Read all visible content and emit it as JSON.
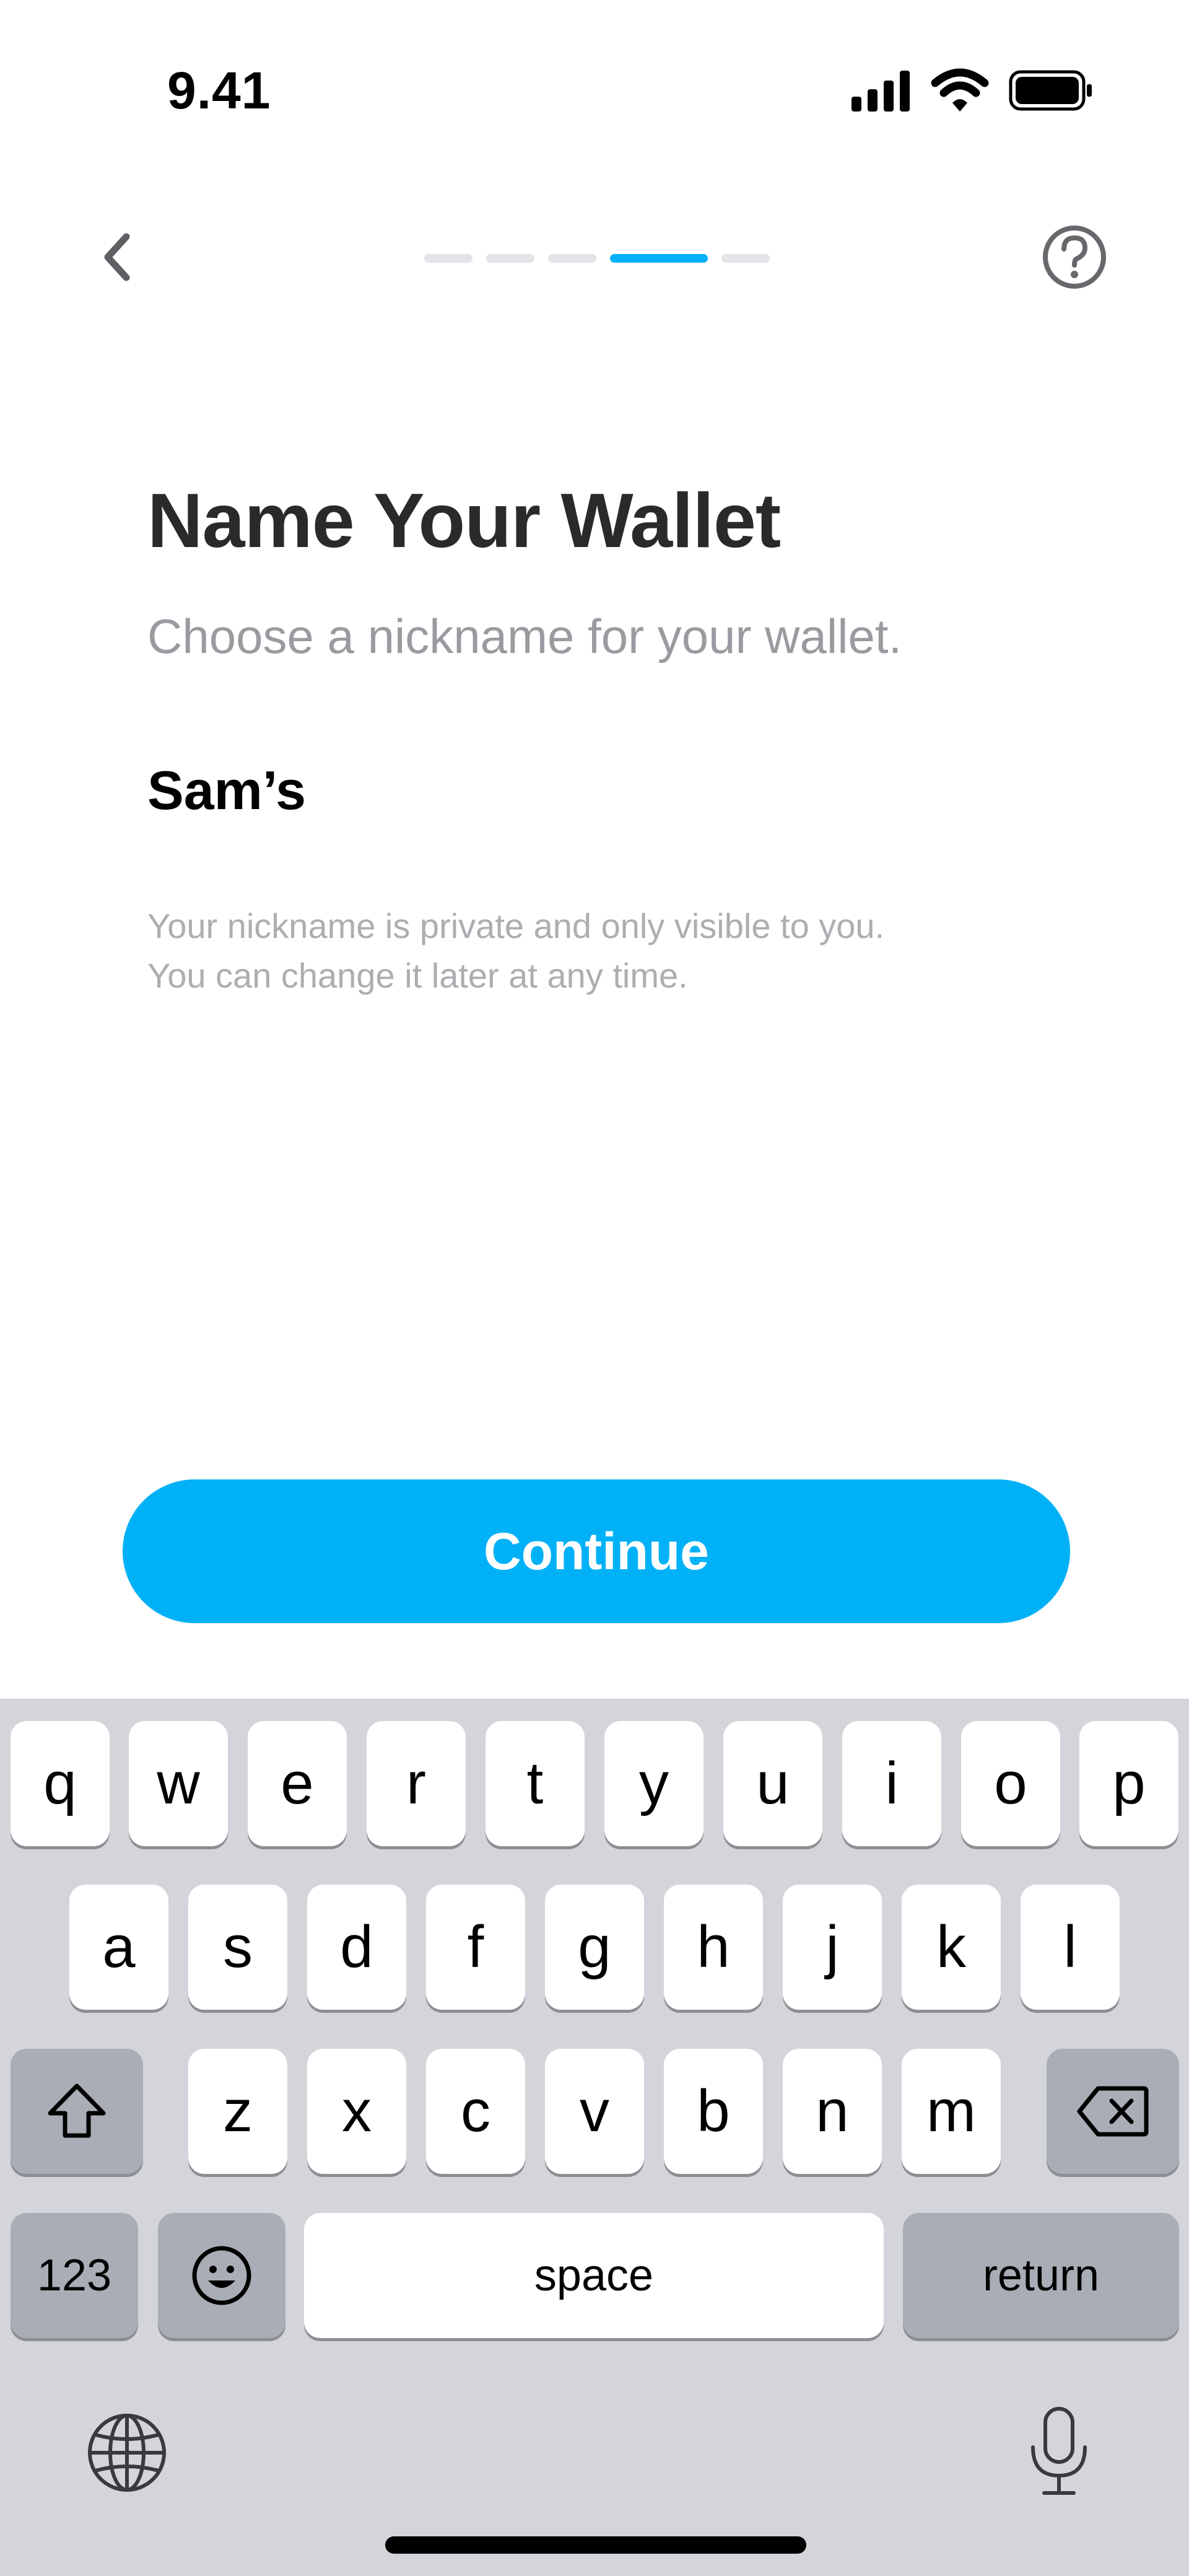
{
  "status_bar": {
    "time": "9.41",
    "icons": [
      "cellular-signal-icon",
      "wifi-icon",
      "battery-icon"
    ]
  },
  "nav": {
    "back_icon": "chevron-left-icon",
    "help_icon": "question-circle-icon",
    "progress": {
      "total_steps": 5,
      "current_step": 4
    }
  },
  "content": {
    "title": "Name Your Wallet",
    "subtitle": "Choose a nickname for your wallet.",
    "nickname_value": "Sam’s",
    "help_line1": "Your nickname is private and only visible to you.",
    "help_line2": "You can change it later at any time."
  },
  "actions": {
    "continue_label": "Continue"
  },
  "keyboard": {
    "row1": [
      "q",
      "w",
      "e",
      "r",
      "t",
      "y",
      "u",
      "i",
      "o",
      "p"
    ],
    "row2": [
      "a",
      "s",
      "d",
      "f",
      "g",
      "h",
      "j",
      "k",
      "l"
    ],
    "row3": [
      "z",
      "x",
      "c",
      "v",
      "b",
      "n",
      "m"
    ],
    "numbers_label": "123",
    "space_label": "space",
    "return_label": "return",
    "icons": [
      "shift-icon",
      "delete-icon",
      "emoji-icon",
      "globe-icon",
      "microphone-icon"
    ]
  },
  "colors": {
    "accent": "#00b1f7",
    "title": "#2a2a2c",
    "subtitle": "#9a9aa0",
    "keyboard_bg": "#d3d5db"
  }
}
